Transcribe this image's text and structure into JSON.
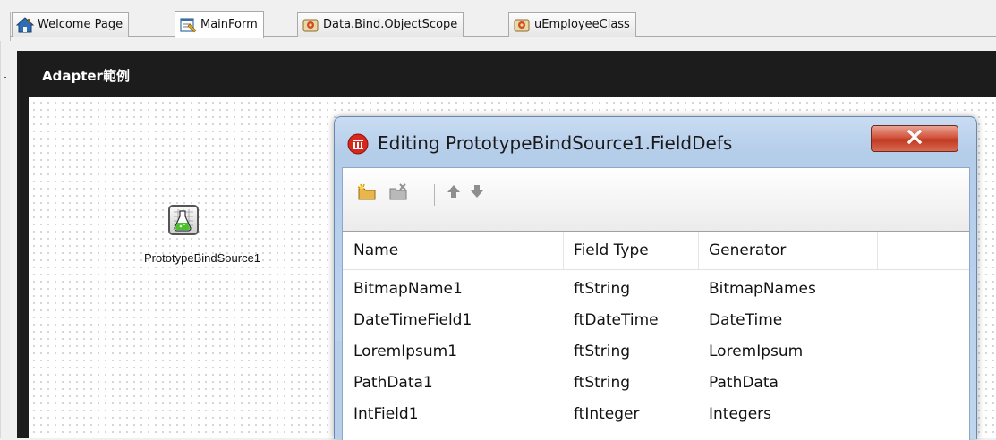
{
  "tabs": [
    {
      "label": "Welcome Page",
      "icon": "house-icon",
      "active": false
    },
    {
      "label": "MainForm",
      "icon": "form-designer-icon",
      "active": true
    },
    {
      "label": "Data.Bind.ObjectScope",
      "icon": "unit-icon",
      "active": false
    },
    {
      "label": "uEmployeeClass",
      "icon": "unit-icon",
      "active": false
    }
  ],
  "form": {
    "title": "Adapter範例",
    "component_label": "PrototypeBindSource1",
    "component_icon": "flask-grid-icon"
  },
  "dialog": {
    "title": "Editing PrototypeBindSource1.FieldDefs",
    "close_icon": "close-icon",
    "toolbar": [
      "add-field-icon",
      "delete-field-icon",
      "move-up-icon",
      "move-down-icon"
    ],
    "columns": [
      "Name",
      "Field Type",
      "Generator"
    ],
    "rows": [
      [
        "BitmapName1",
        "ftString",
        "BitmapNames"
      ],
      [
        "DateTimeField1",
        "ftDateTime",
        "DateTime"
      ],
      [
        "LoremIpsum1",
        "ftString",
        "LoremIpsum"
      ],
      [
        "PathData1",
        "ftString",
        "PathData"
      ],
      [
        "IntField1",
        "ftInteger",
        "Integers"
      ]
    ]
  },
  "colors": {
    "form_background": "#1c1c1c",
    "dialog_frame": "#b4cde9",
    "close_button": "#c03a22"
  }
}
